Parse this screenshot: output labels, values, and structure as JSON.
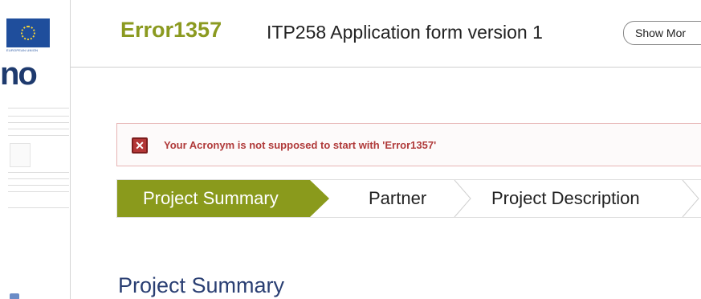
{
  "sidebar": {
    "eu_caption": "EUROPEAN UNION",
    "logo_fragment": "no"
  },
  "header": {
    "acronym": "Error1357",
    "form_title": "ITP258 Application form version 1",
    "show_more_label": "Show Mor"
  },
  "error": {
    "message": "Your Acronym is not supposed to start with 'Error1357'",
    "icon": "error-x-icon"
  },
  "steps": [
    {
      "label": "Project Summary",
      "active": true
    },
    {
      "label": "Partner",
      "active": false
    },
    {
      "label": "Project Description",
      "active": false
    }
  ],
  "section": {
    "heading": "Project Summary"
  },
  "colors": {
    "accent": "#8a9a1c",
    "acronym": "#8b9a20",
    "error_text": "#b03a3a",
    "heading": "#2a3f73"
  }
}
